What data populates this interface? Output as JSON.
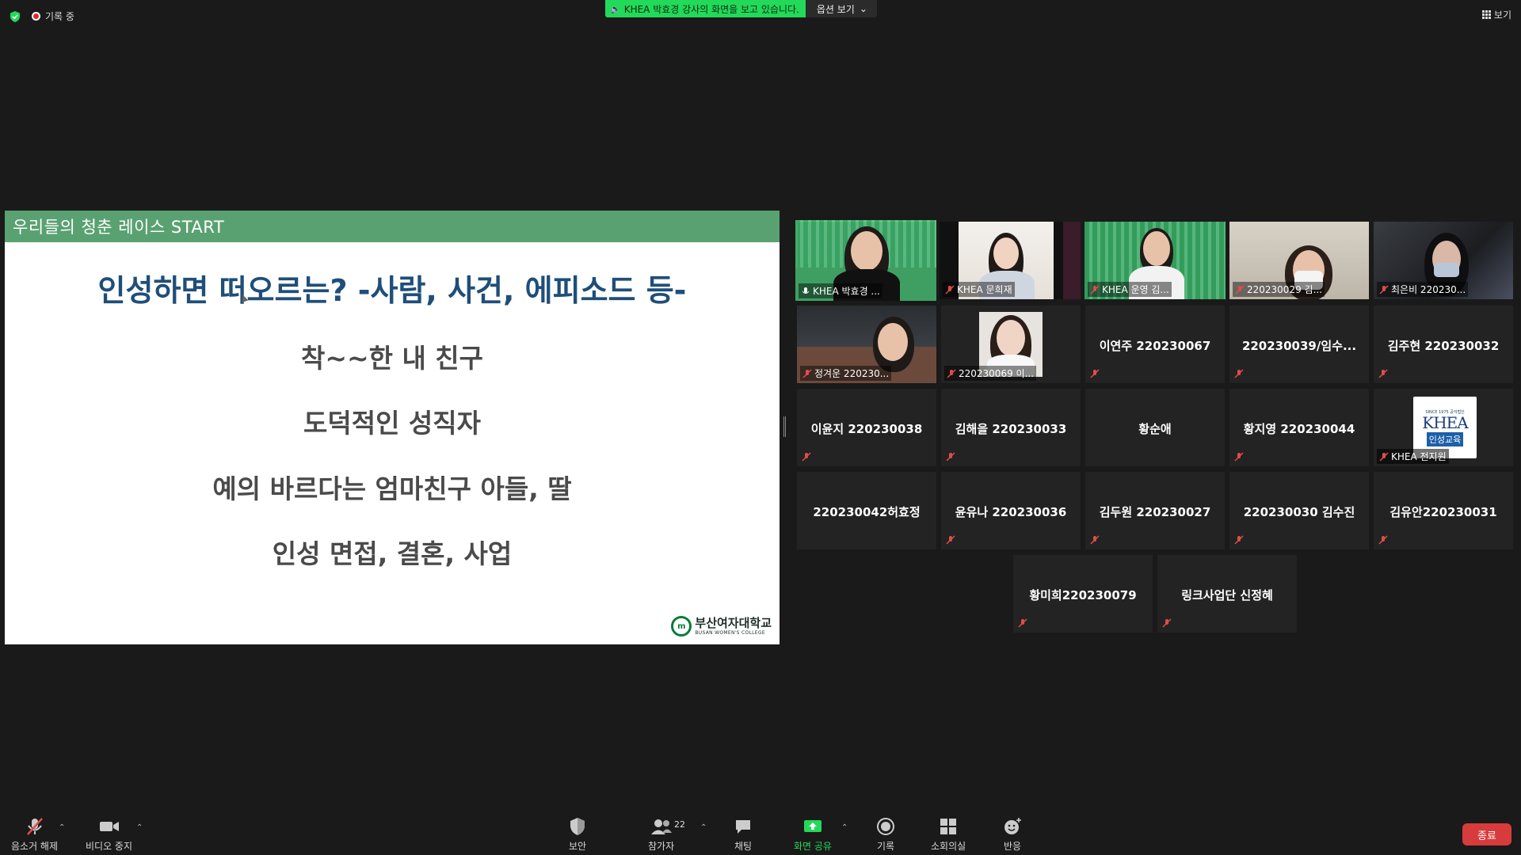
{
  "top": {
    "recording": "기록 중",
    "share_banner": "KHEA 박효경 강사의 화면을 보고 있습니다.",
    "view_options": "옵션 보기",
    "view": "보기"
  },
  "slide": {
    "header": "우리들의 청춘 레이스 START",
    "title": "인성하면 떠오르는? -사람, 사건, 에피소드 등-",
    "items": [
      "착~~한 내 친구",
      "도덕적인 성직자",
      "예의 바르다는 엄마친구 아들, 딸",
      "인성 면접, 결혼, 사업"
    ],
    "college_ko": "부산여자대학교",
    "college_en": "BUSAN WOMEN'S COLLEGE"
  },
  "participants": [
    {
      "name": "KHEA 박효경 ...",
      "video": true
    },
    {
      "name": "KHEA 문희재",
      "video": true
    },
    {
      "name": "KHEA 운영 김...",
      "video": true
    },
    {
      "name": "220230029 김...",
      "video": true
    },
    {
      "name": "최은비 220230...",
      "video": true
    },
    {
      "name": "정겨운 220230...",
      "video": true
    },
    {
      "name": "220230069 이...",
      "video": true
    },
    {
      "name": "이연주 220230067",
      "video": false
    },
    {
      "name": "220230039/임수...",
      "video": false
    },
    {
      "name": "김주현 220230032",
      "video": false
    },
    {
      "name": "이윤지 220230038",
      "video": false
    },
    {
      "name": "김해을 220230033",
      "video": false
    },
    {
      "name": "황순애",
      "video": false
    },
    {
      "name": "황지영 220230044",
      "video": false
    },
    {
      "name": "KHEA 전지원",
      "video": true
    },
    {
      "name": "220230042허효정",
      "video": false
    },
    {
      "name": "윤유나 220230036",
      "video": false
    },
    {
      "name": "김두원 220230027",
      "video": false
    },
    {
      "name": "220230030 김수진",
      "video": false
    },
    {
      "name": "김유안220230031",
      "video": false
    },
    {
      "name": "황미희220230079",
      "video": false
    },
    {
      "name": "링크사업단 신정혜",
      "video": false
    }
  ],
  "khea_logo": {
    "since": "SINCE 1975 공익법인",
    "brand": "KHEA",
    "sub": "인성교육"
  },
  "toolbar": {
    "unmute": "음소거 해제",
    "stop_video": "비디오 중지",
    "security": "보안",
    "participants": "참가자",
    "participants_count": "22",
    "chat": "채팅",
    "share_screen": "화면 공유",
    "record": "기록",
    "breakout": "소회의실",
    "reactions": "반응",
    "end": "종료"
  },
  "colors": {
    "share_green": "#23d959",
    "slide_header": "#5aa171",
    "title_blue": "#1f4e79",
    "end_red": "#d83b3b",
    "active_speaker": "#f0e16a"
  }
}
